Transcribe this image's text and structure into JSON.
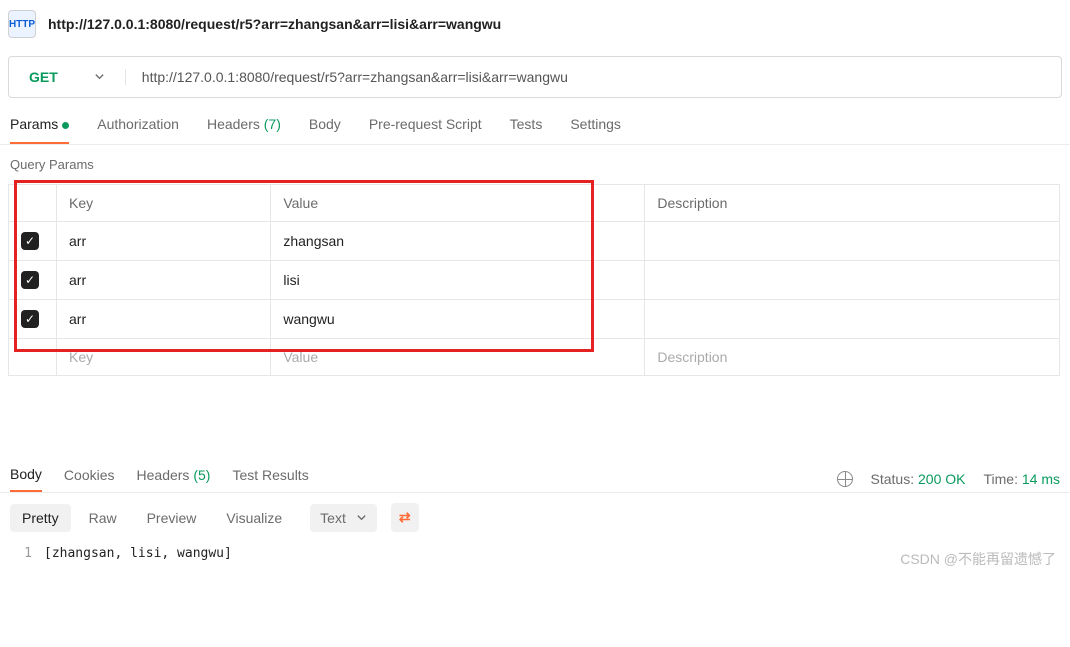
{
  "top_url": "http://127.0.0.1:8080/request/r5?arr=zhangsan&arr=lisi&arr=wangwu",
  "method": "GET",
  "url": "http://127.0.0.1:8080/request/r5?arr=zhangsan&arr=lisi&arr=wangwu",
  "tabs": {
    "params": "Params",
    "auth": "Authorization",
    "headers": "Headers",
    "headers_count": "(7)",
    "body": "Body",
    "prerequest": "Pre-request Script",
    "tests": "Tests",
    "settings": "Settings"
  },
  "section_title": "Query Params",
  "columns": {
    "key": "Key",
    "value": "Value",
    "description": "Description"
  },
  "rows": [
    {
      "enabled": true,
      "key": "arr",
      "value": "zhangsan"
    },
    {
      "enabled": true,
      "key": "arr",
      "value": "lisi"
    },
    {
      "enabled": true,
      "key": "arr",
      "value": "wangwu"
    }
  ],
  "placeholder": {
    "key": "Key",
    "value": "Value",
    "description": "Description"
  },
  "response_tabs": {
    "body": "Body",
    "cookies": "Cookies",
    "headers": "Headers",
    "headers_count": "(5)",
    "tests": "Test Results"
  },
  "status": {
    "label": "Status:",
    "code": "200 OK",
    "time_label": "Time:",
    "time": "14 ms"
  },
  "view_modes": {
    "pretty": "Pretty",
    "raw": "Raw",
    "preview": "Preview",
    "visualize": "Visualize"
  },
  "lang": "Text",
  "body_line_no": "1",
  "body_text": "[zhangsan, lisi, wangwu]",
  "watermark": "CSDN @不能再留遗憾了"
}
